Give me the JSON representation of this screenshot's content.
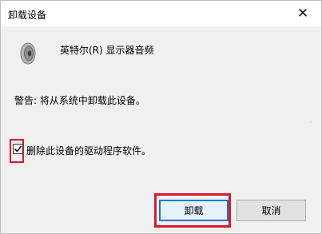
{
  "window": {
    "title": "卸载设备",
    "close_label": "✕"
  },
  "device": {
    "icon": "speaker-icon",
    "name": "英特尔(R) 显示器音频"
  },
  "warning_text": "警告: 将从系统中卸载此设备。",
  "delete_driver": {
    "checked": true,
    "label": "删除此设备的驱动程序软件。"
  },
  "buttons": {
    "uninstall_label": "卸载",
    "cancel_label": "取消"
  },
  "colors": {
    "highlight_red": "#e0162b",
    "default_button_border": "#0078d7",
    "dialog_background": "#f0f0f0"
  }
}
